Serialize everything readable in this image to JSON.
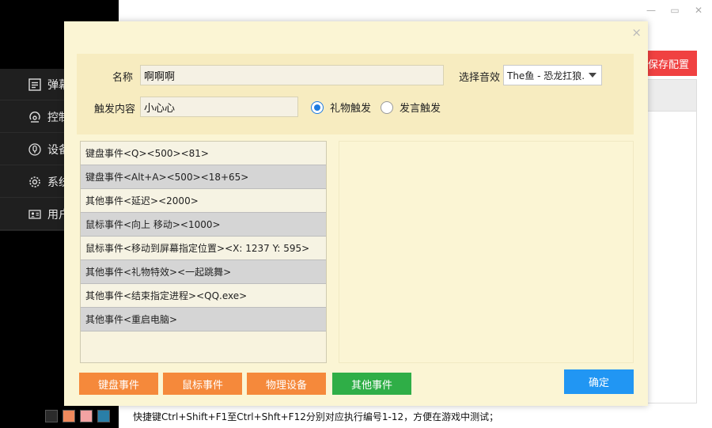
{
  "window_controls": {
    "minimize": "—",
    "maximize": "▭",
    "close": "✕"
  },
  "sidebar": {
    "items": [
      {
        "label": "弹幕",
        "icon": "list-icon"
      },
      {
        "label": "控制",
        "icon": "control-icon"
      },
      {
        "label": "设备",
        "icon": "microphone-icon"
      },
      {
        "label": "系统",
        "icon": "gear-icon"
      },
      {
        "label": "用户",
        "icon": "user-card-icon"
      }
    ]
  },
  "background": {
    "save_config_label": "保存配置",
    "swatch_colors": [
      "#2b2b2b",
      "#f08a5d",
      "#f3a3a3",
      "#2a7fa8"
    ],
    "hint_text": "快捷键Ctrl+Shift+F1至Ctrl+Shft+F12分别对应执行编号1-12，方便在游戏中测试；"
  },
  "dialog": {
    "close_label": "×",
    "name_label": "名称",
    "name_value": "啊啊啊",
    "sound_label": "选择音效",
    "sound_value": "The鱼 - 恐龙扛狼.",
    "trigger_content_label": "触发内容",
    "trigger_content_value": "小心心",
    "trigger_modes": [
      {
        "label": "礼物触发",
        "checked": true
      },
      {
        "label": "发言触发",
        "checked": false
      }
    ],
    "events": [
      "键盘事件<Q><500><81>",
      "键盘事件<Alt+A><500><18+65>",
      "其他事件<延迟><2000>",
      "鼠标事件<向上 移动><1000>",
      "鼠标事件<移动到屏幕指定位置><X: 1237  Y: 595>",
      "其他事件<礼物特效><一起跳舞>",
      "其他事件<结束指定进程><QQ.exe>",
      "其他事件<重启电脑>"
    ],
    "buttons": {
      "keyboard": "键盘事件",
      "mouse": "鼠标事件",
      "physical": "物理设备",
      "other": "其他事件",
      "confirm": "确定"
    }
  },
  "colors": {
    "dialog_bg": "#fbf5d4",
    "form_bg": "#f7ecc0",
    "orange": "#f5893b",
    "green": "#2fae47",
    "blue": "#2196f3",
    "save_red": "#f04141"
  }
}
